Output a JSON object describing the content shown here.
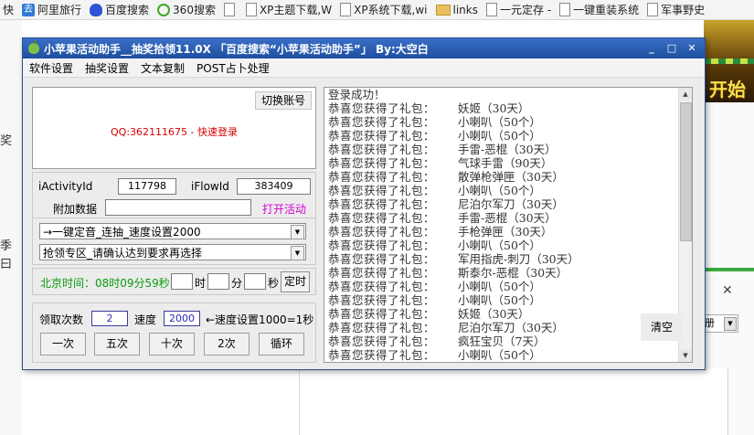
{
  "bookmarks": [
    {
      "label": "快",
      "icon": "none"
    },
    {
      "label": "阿里旅行",
      "icon": "ali-icon"
    },
    {
      "label": "百度搜索",
      "icon": "baidu-paw-icon"
    },
    {
      "label": "360搜索",
      "icon": "360-icon"
    },
    {
      "label": "",
      "icon": "page-icon"
    },
    {
      "label": "XP主题下载,W",
      "icon": "page-icon"
    },
    {
      "label": "XP系统下载,wi",
      "icon": "page-icon"
    },
    {
      "label": "links",
      "icon": "folder-icon"
    },
    {
      "label": "一元定存 -",
      "icon": "page-icon"
    },
    {
      "label": "一键重装系统",
      "icon": "page-icon"
    },
    {
      "label": "军事野史",
      "icon": "page-icon"
    }
  ],
  "background": {
    "left_fragments": [
      "奖",
      "季",
      "曰"
    ],
    "banner_text": "开始",
    "select_text": "册"
  },
  "window": {
    "title": "小苹果活动助手__抽奖拾领11.0X 「百度搜索“小苹果活动助手”」 By:大空白",
    "min": "_",
    "max": "□",
    "close": "✕"
  },
  "menu": [
    "软件设置",
    "抽奖设置",
    "文本复制",
    "POST占卜处理"
  ],
  "account": {
    "switch_label": "切换账号",
    "qq_text": "QQ:362111675 - 快速登录"
  },
  "params": {
    "activity_label": "iActivityId",
    "activity_value": "117798",
    "flow_label": "iFlowId",
    "flow_value": "383409",
    "extra_label": "附加数据",
    "extra_value": "",
    "open_label": "打开活动"
  },
  "combos": {
    "mode": "→一键定音_连抽_速度设置2000",
    "zone": "抢领专区_请确认达到要求再选择"
  },
  "timer": {
    "label": "北京时间：08时09分59秒",
    "hour_unit": "时",
    "min_unit": "分",
    "sec_unit": "秒",
    "start_label": "定时"
  },
  "controls": {
    "count_label": "领取次数",
    "count_value": "2",
    "speed_label": "速度",
    "speed_value": "2000",
    "speed_note": "←速度设置1000=1秒",
    "btn_once": "一次",
    "btn_five": "五次",
    "btn_ten": "十次",
    "btn_two": "2次",
    "btn_loop": "循环"
  },
  "log": {
    "clear_label": "清空",
    "first": "登录成功！",
    "prefix": "恭喜您获得了礼包：",
    "items": [
      "妖姬（30天）",
      "小喇叭（50个）",
      "小喇叭（50个）",
      "手雷-恶棍（30天）",
      "气球手雷（90天）",
      "散弹枪弹匣（30天）",
      "小喇叭（50个）",
      "尼泊尔军刀（30天）",
      "手雷-恶棍（30天）",
      "手枪弹匣（30天）",
      "小喇叭（50个）",
      "军用指虎-刺刀（30天）",
      "斯泰尔-恶棍（30天）",
      "小喇叭（50个）",
      "小喇叭（50个）",
      "妖姬（30天）",
      "尼泊尔军刀（30天）",
      "疯狂宝贝（7天）",
      "小喇叭（50个）"
    ]
  },
  "colors": {
    "title_bar": "#2a5fb5",
    "qq_text": "#d60000",
    "time_text": "#0a9b0a",
    "open_link": "#d400d4",
    "value_text": "#2a2ab6"
  }
}
